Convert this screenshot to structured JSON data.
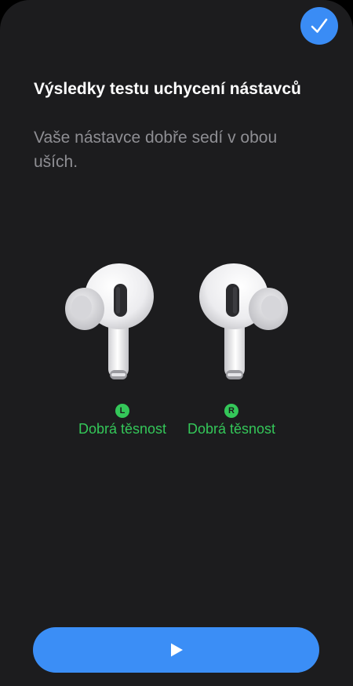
{
  "header": {
    "title": "Výsledky testu uchycení nástavců",
    "subtitle": "Vaše nástavce dobře sedí v obou uších.",
    "done_icon": "checkmark-icon"
  },
  "results": {
    "left": {
      "badge": "L",
      "status": "Dobrá těsnost"
    },
    "right": {
      "badge": "R",
      "status": "Dobrá těsnost"
    }
  },
  "footer": {
    "play_icon": "play-icon"
  },
  "colors": {
    "background": "#1c1c1e",
    "accent": "#3a8cf5",
    "success": "#34c759",
    "secondary_text": "#8e8e93"
  }
}
